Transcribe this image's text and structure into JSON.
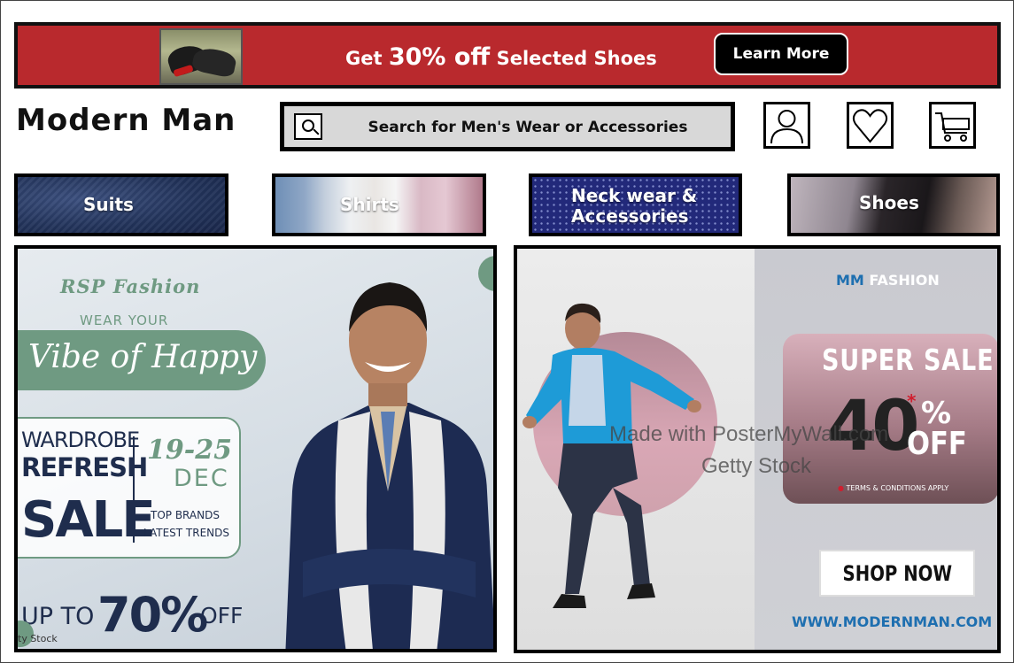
{
  "promo": {
    "prefix": "Get ",
    "highlight": "30% off",
    "suffix": " Selected Shoes",
    "cta_label": "Learn More",
    "thumb_icon": "dress-shoes-photo"
  },
  "header": {
    "brand": "Modern Man",
    "search_placeholder": "Search for Men's Wear or Accessories",
    "icons": [
      "user-icon",
      "heart-icon",
      "cart-icon"
    ]
  },
  "categories": [
    {
      "label_lines": [
        "Suits"
      ]
    },
    {
      "label_lines": [
        "Shirts"
      ]
    },
    {
      "label_lines": [
        "Neck wear &",
        "Accessories"
      ]
    },
    {
      "label_lines": [
        "Shoes"
      ]
    }
  ],
  "poster_left": {
    "brand": "RSP Fashion",
    "wear_your": "WEAR YOUR",
    "vibe": "Vibe of Happy",
    "wardrobe": "WARDROBE",
    "refresh": "REFRESH",
    "sale": "SALE",
    "dates": "19-25",
    "month": "DEC",
    "top_brands": "TOP BRANDS",
    "latest_trends": "LATEST TRENDS",
    "up_to": "UP TO",
    "percent": "70%",
    "off": "OFF",
    "stock_credit": "ty Stock"
  },
  "poster_right": {
    "brand_mm": "MM",
    "brand_fashion": " FASHION",
    "super_sale": "SUPER SALE",
    "discount_number": "40",
    "discount_star": "*",
    "discount_percent": "%",
    "discount_off": "OFF",
    "terms": "TERMS & CONDITIONS APPLY",
    "shop_now": "SHOP NOW",
    "url": "WWW.MODERNMAN.COM",
    "watermark_1": "Made with PosterMyWall.com",
    "watermark_2": "Getty Stock"
  },
  "colors": {
    "banner_red": "#b9292d",
    "sage_green": "#6f9a82",
    "navy": "#1f2d4d",
    "link_blue": "#1e6fb0"
  }
}
